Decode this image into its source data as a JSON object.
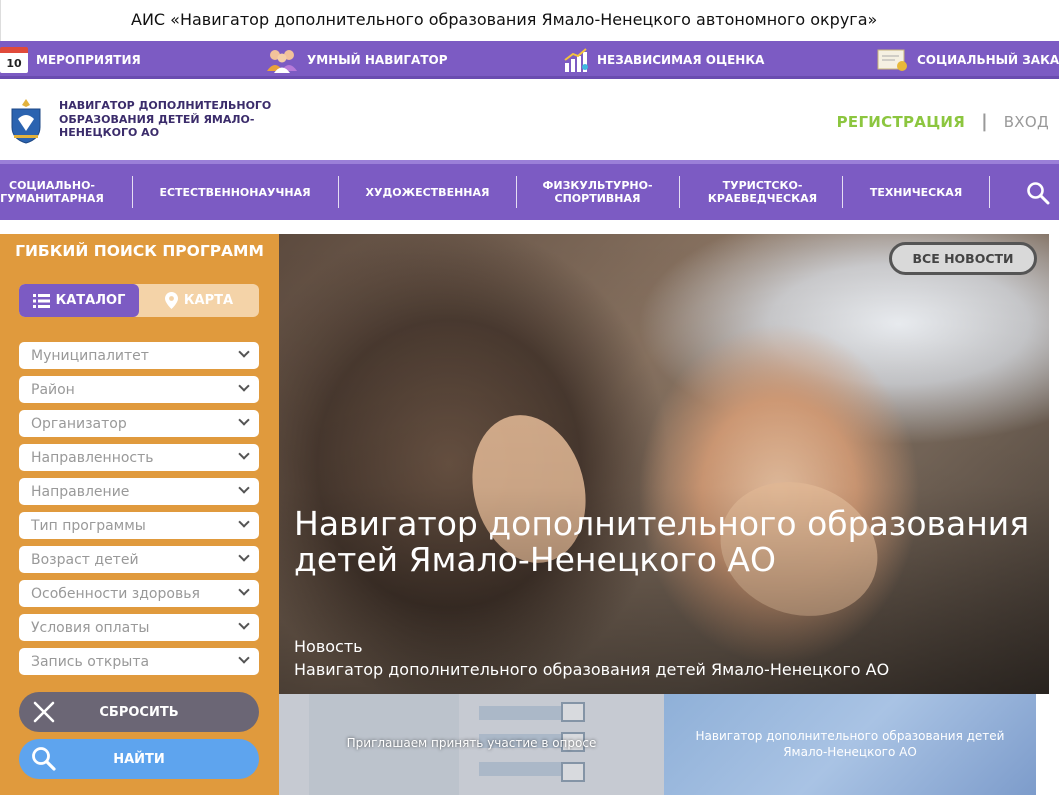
{
  "topbar": {
    "title": "АИС «Навигатор дополнительного образования Ямало-Ненецкого автономного округа»"
  },
  "services": [
    {
      "label": "Мероприятия",
      "icon": "calendar-icon",
      "badge": "10"
    },
    {
      "label": "Умный навигатор",
      "icon": "people-icon"
    },
    {
      "label": "Независимая оценка",
      "icon": "chart-growth-icon"
    },
    {
      "label": "Социальный заказ",
      "icon": "certificate-icon"
    }
  ],
  "header": {
    "logo_text": "Навигатор дополнительного образования детей Ямало-Ненецкого АО",
    "register": "Регистрация",
    "separator": "|",
    "login": "Вход"
  },
  "categories": [
    "Социально-гуманитарная",
    "Естественнонаучная",
    "Художественная",
    "Физкультурно-спортивная",
    "Туристско-краеведческая",
    "Техническая"
  ],
  "sidebar": {
    "title": "Гибкий поиск программ",
    "tab_catalog": "Каталог",
    "tab_map": "Карта",
    "filters": [
      "Муниципалитет",
      "Район",
      "Организатор",
      "Направленность",
      "Направление",
      "Тип программы",
      "Возраст детей",
      "Особенности здоровья",
      "Условия оплаты",
      "Запись открыта"
    ],
    "reset": "Сбросить",
    "find": "Найти"
  },
  "hero": {
    "all_news": "Все новости",
    "title": "Навигатор дополнительного образования детей Ямало-Ненецкого АО",
    "tag": "Новость",
    "subtitle": "Навигатор дополнительного образования детей Ямало-Ненецкого АО"
  },
  "cards": [
    {
      "caption": "Приглашаем принять участие в опросе"
    },
    {
      "caption": "Навигатор дополнительного образования детей Ямало-Ненецкого АО"
    }
  ],
  "colors": {
    "purple": "#7c5bc3",
    "orange": "#e09a3d",
    "green": "#8cc63f",
    "blue": "#5ea4ee"
  }
}
